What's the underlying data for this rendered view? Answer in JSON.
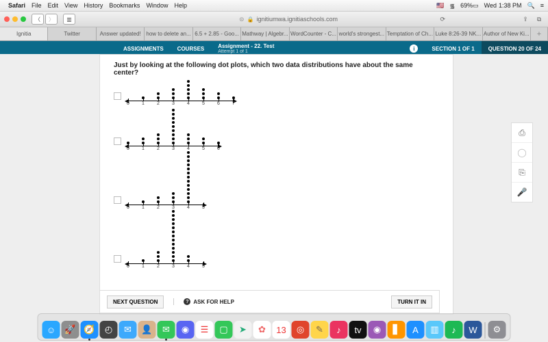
{
  "menubar": {
    "app": "Safari",
    "items": [
      "File",
      "Edit",
      "View",
      "History",
      "Bookmarks",
      "Window",
      "Help"
    ],
    "flag": "🇺🇸",
    "wifi": "⏚",
    "battery": "69%",
    "day": "Wed",
    "time": "1:38 PM"
  },
  "toolbar": {
    "url": "ignitiumwa.ignitiaschools.com"
  },
  "tabs": [
    "Ignitia",
    "Twitter",
    "Answer updated!",
    "how to delete an...",
    "6.5 + 2.85 - Goo...",
    "Mathway | Algebr...",
    "WordCounter - C...",
    "world's strongest...",
    "Temptation of Ch...",
    "Luke 8:26-39 NK...",
    "Author of New Ki..."
  ],
  "pageheader": {
    "nav": [
      "ASSIGNMENTS",
      "COURSES"
    ],
    "assignment_label": "Assignment",
    "assignment_title": "- 22. Test",
    "attempt": "Attempt 1 of 1",
    "section": "SECTION 1 OF 1",
    "question": "QUESTION 20 OF 24"
  },
  "question": "Just by looking at the following dot plots, which two data distributions have about the same center?",
  "buttons": {
    "next": "NEXT QUESTION",
    "ask": "ASK FOR HELP",
    "turnin": "TURN IT IN"
  },
  "sidetools": [
    "print-icon",
    "globe-icon",
    "copy-icon",
    "mic-icon"
  ],
  "chart_data": [
    {
      "type": "dotplot",
      "xmin": 0,
      "xmax": 7,
      "counts": {
        "0": 0,
        "1": 1,
        "2": 2,
        "3": 3,
        "4": 5,
        "5": 3,
        "6": 2,
        "7": 1
      }
    },
    {
      "type": "dotplot",
      "xmin": 0,
      "xmax": 6,
      "counts": {
        "0": 1,
        "1": 2,
        "2": 3,
        "3": 9,
        "4": 3,
        "5": 2,
        "6": 1
      }
    },
    {
      "type": "dotplot",
      "xmin": 0,
      "xmax": 5,
      "counts": {
        "0": 0,
        "1": 1,
        "2": 2,
        "3": 3,
        "4": 13,
        "5": 0
      }
    },
    {
      "type": "dotplot",
      "xmin": 0,
      "xmax": 5,
      "counts": {
        "0": 0,
        "1": 1,
        "2": 3,
        "3": 13,
        "4": 2,
        "5": 0
      }
    }
  ],
  "dock": [
    {
      "n": "finder",
      "c": "#2aa7ff",
      "g": "☺"
    },
    {
      "n": "launchpad",
      "c": "#8e8e8e",
      "g": "🚀"
    },
    {
      "n": "safari",
      "c": "#1e90ff",
      "g": "🧭",
      "on": true
    },
    {
      "n": "dashboard",
      "c": "#444",
      "g": "◴"
    },
    {
      "n": "mail",
      "c": "#3da9fc",
      "g": "✉"
    },
    {
      "n": "contacts",
      "c": "#d9b38c",
      "g": "👤"
    },
    {
      "n": "messages",
      "c": "#34c759",
      "g": "✉",
      "on": true
    },
    {
      "n": "discord",
      "c": "#5865f2",
      "g": "◉"
    },
    {
      "n": "reminders",
      "c": "#fff",
      "g": "☰",
      "tc": "#e33"
    },
    {
      "n": "facetime",
      "c": "#34c759",
      "g": "▢"
    },
    {
      "n": "maps",
      "c": "#f2f2f2",
      "g": "➤",
      "tc": "#2a7"
    },
    {
      "n": "photos",
      "c": "#fff",
      "g": "✿",
      "tc": "#e66"
    },
    {
      "n": "calendar",
      "c": "#fff",
      "g": "13",
      "tc": "#e33"
    },
    {
      "n": "photobooth",
      "c": "#e0452c",
      "g": "◎"
    },
    {
      "n": "notes",
      "c": "#ffd54a",
      "g": "✎",
      "tc": "#765"
    },
    {
      "n": "itunes",
      "c": "#ea3360",
      "g": "♪"
    },
    {
      "n": "appletv",
      "c": "#111",
      "g": "tv"
    },
    {
      "n": "podcasts",
      "c": "#9b59b6",
      "g": "◉"
    },
    {
      "n": "ibooks",
      "c": "#ff9500",
      "g": "▋"
    },
    {
      "n": "appstore",
      "c": "#1e90ff",
      "g": "A"
    },
    {
      "n": "preview",
      "c": "#5ac8fa",
      "g": "▥"
    },
    {
      "n": "spotify",
      "c": "#1db954",
      "g": "♪"
    },
    {
      "n": "word",
      "c": "#2b579a",
      "g": "W"
    },
    {
      "n": "settings",
      "c": "#8e8e93",
      "g": "⚙"
    }
  ]
}
